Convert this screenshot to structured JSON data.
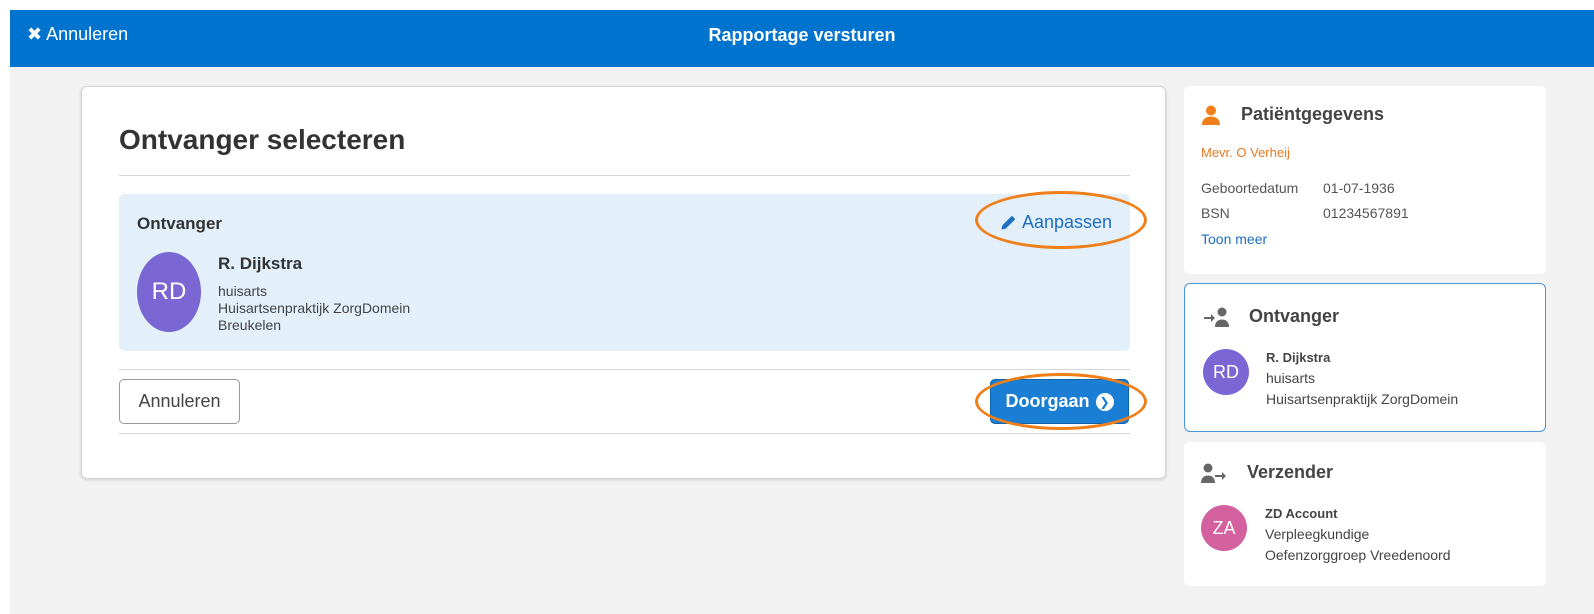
{
  "topbar": {
    "cancel_label": "Annuleren",
    "title": "Rapportage versturen",
    "color": "#0073cf"
  },
  "main": {
    "title": "Ontvanger selecteren",
    "recipient_label": "Ontvanger",
    "edit_label": "Aanpassen",
    "recipient": {
      "initials": "RD",
      "name": "R. Dijkstra",
      "role": "huisarts",
      "practice": "Huisartsenpraktijk ZorgDomein",
      "city": "Breukelen",
      "avatar_color": "#7b67d3"
    },
    "cancel_button": "Annuleren",
    "continue_button": "Doorgaan"
  },
  "patient": {
    "heading": "Patiëntgegevens",
    "name": "Mevr. O Verheij",
    "birth_label": "Geboortedatum",
    "birth_value": "01-07-1936",
    "bsn_label": "BSN",
    "bsn_value": "01234567891",
    "more_link": "Toon meer"
  },
  "recipient_panel": {
    "heading": "Ontvanger",
    "initials": "RD",
    "name": "R. Dijkstra",
    "role": "huisarts",
    "practice": "Huisartsenpraktijk ZorgDomein"
  },
  "sender_panel": {
    "heading": "Verzender",
    "initials": "ZA",
    "name": "ZD Account",
    "role": "Verpleegkundige",
    "organisation": "Oefenzorggroep Vreedenoord",
    "avatar_color": "#d3619f"
  },
  "highlight_color": "#f07f19",
  "icons": [
    "close-icon",
    "pencil-icon",
    "chevron-right-circle-icon",
    "person-icon",
    "recipient-icon",
    "sender-icon"
  ]
}
